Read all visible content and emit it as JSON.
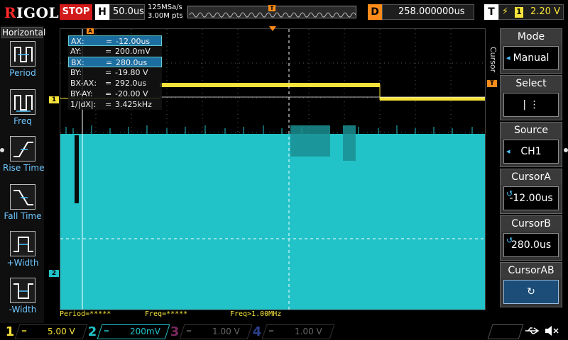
{
  "topbar": {
    "brand_r": "R",
    "brand_rest": "IGOL",
    "run_state": "STOP",
    "h_key": "H",
    "timebase": "50.0us",
    "sample_rate": "125MSa/s",
    "memory_depth": "3.00M pts",
    "trig_pos_marker": "T",
    "d_key": "D",
    "delay": "258.000000us",
    "t_key": "T",
    "trig_edge": "⚡",
    "trig_source": "1",
    "trig_level": "2.20 V"
  },
  "left_menu": {
    "title": "Horizontal",
    "items": [
      {
        "label": "Period",
        "icon": "period-icon"
      },
      {
        "label": "Freq",
        "icon": "freq-icon"
      },
      {
        "label": "Rise Time",
        "icon": "rise-time-icon"
      },
      {
        "label": "Fall Time",
        "icon": "fall-time-icon"
      },
      {
        "label": "+Width",
        "icon": "pos-width-icon"
      },
      {
        "label": "-Width",
        "icon": "neg-width-icon"
      }
    ]
  },
  "cursor_table": {
    "rows": [
      {
        "k": "AX:",
        "v": "-12.00us"
      },
      {
        "k": "AY:",
        "v": "200.0mV"
      },
      {
        "k": "BX:",
        "v": "280.0us"
      },
      {
        "k": "BY:",
        "v": "-19.80 V"
      },
      {
        "k": "BX-AX:",
        "v": "292.0us"
      },
      {
        "k": "BY-AY:",
        "v": "-20.00 V"
      },
      {
        "k": "1/|dX|:",
        "v": "3.425kHz"
      }
    ],
    "eq": "="
  },
  "markers": {
    "ch1": "1",
    "ch2": "2",
    "trig": "T",
    "cursor_a_flag": "A"
  },
  "measure_status": {
    "period": "Period=*****",
    "freq": "Freq=*****",
    "freq_limit": "Freq>1.00MHz"
  },
  "right_menu": {
    "vertical_label": "Cursor",
    "mode_title": "Mode",
    "mode_value": "Manual",
    "select_title": "Select",
    "select_value": "|   ⋮",
    "source_title": "Source",
    "source_value": "CH1",
    "cursora_title": "CursorA",
    "cursora_value": "-12.00us",
    "cursorb_title": "CursorB",
    "cursorb_value": "280.0us",
    "cursorab_title": "CursorAB",
    "cursorab_value": "↻",
    "arrow": "◂",
    "knob": "↺"
  },
  "channels": [
    {
      "num": "1",
      "coupling": "═",
      "scale": "5.00 V",
      "color": "#f5e23a"
    },
    {
      "num": "2",
      "coupling": "═",
      "scale": "200mV",
      "color": "#22c3c8"
    },
    {
      "num": "3",
      "coupling": "═",
      "scale": "1.00 V",
      "color": "#b6348e"
    },
    {
      "num": "4",
      "coupling": "═",
      "scale": "1.00 V",
      "color": "#3b5fd8"
    }
  ],
  "colors": {
    "ch1": "#f5e23a",
    "ch2": "#22c3c8",
    "trigger": "#ff8c1a",
    "cursor": "#ffffff"
  }
}
